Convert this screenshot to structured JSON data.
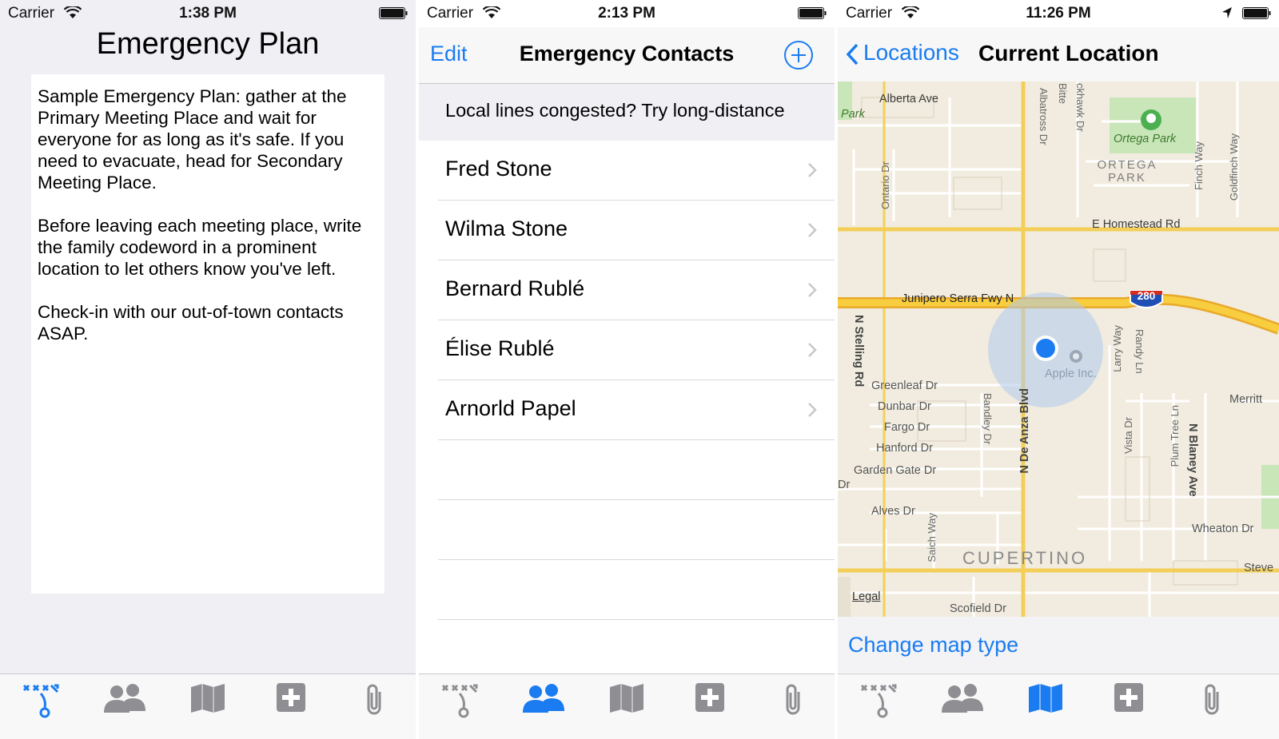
{
  "colors": {
    "accent": "#1a7cf0",
    "tab_inactive": "#8e8e93",
    "tab_active": "#1a7cf0"
  },
  "panel1": {
    "status": {
      "carrier": "Carrier",
      "time": "1:38 PM"
    },
    "title": "Emergency Plan",
    "paragraphs": [
      "Sample Emergency Plan: gather at the Primary Meeting Place and wait for everyone for as long as it's safe. If you need to evacuate, head for Secondary Meeting Place.",
      "Before leaving each meeting place, write the family codeword in a prominent location to let others know you've left.",
      "Check-in with our out-of-town contacts ASAP."
    ],
    "active_tab": "plan"
  },
  "panel2": {
    "status": {
      "carrier": "Carrier",
      "time": "2:13 PM"
    },
    "nav": {
      "edit": "Edit",
      "title": "Emergency Contacts",
      "add_icon": "add-circle-icon"
    },
    "banner": "Local lines congested? Try long-distance",
    "contacts": [
      "Fred Stone",
      "Wilma Stone",
      "Bernard Rublé",
      "Élise Rublé",
      "Arnorld Papel"
    ],
    "active_tab": "contacts"
  },
  "panel3": {
    "status": {
      "carrier": "Carrier",
      "time": "11:26 PM"
    },
    "nav": {
      "back": "Locations",
      "title": "Current Location"
    },
    "map": {
      "labels": {
        "alberta": "Alberta Ave",
        "park": "Park",
        "albatross": "Albatross Dr",
        "bitte": "Bitte",
        "ckhawk": "ckhawk Dr",
        "ortega_park": "Ortega Park",
        "ortega_park_caps": "ORTEGA PARK",
        "finch": "Finch Way",
        "goldfinch": "Goldfinch Way",
        "ontario": "Ontario Dr",
        "homestead": "E Homestead Rd",
        "junipero": "Junipero Serra Fwy N",
        "i280": "280",
        "stelling": "N Stelling Rd",
        "larry": "Larry Way",
        "randy": "Randy Ln",
        "apple": "Apple Inc.",
        "greenleaf": "Greenleaf Dr",
        "dunbar": "Dunbar Dr",
        "fargo": "Fargo Dr",
        "hanford": "Hanford Dr",
        "garden_gate": "Garden Gate Dr",
        "bandley": "Bandley Dr",
        "de_anza": "N De Anza Blvd",
        "vista": "Vista Dr",
        "plum_tree": "Plum Tree Ln",
        "blaney": "N Blaney Ave",
        "merritt": "Merritt",
        "dr": "Dr",
        "alves": "Alves Dr",
        "saich": "Saich Way",
        "wheaton": "Wheaton Dr",
        "cupertino": "CUPERTINO",
        "steve": "Steve",
        "legal": "Legal",
        "scofield": "Scofield Dr"
      }
    },
    "change_map": "Change map type",
    "active_tab": "map"
  },
  "tabs": [
    {
      "key": "plan",
      "icon": "strategy-plan-icon"
    },
    {
      "key": "contacts",
      "icon": "contacts-group-icon"
    },
    {
      "key": "map",
      "icon": "folded-map-icon"
    },
    {
      "key": "firstaid",
      "icon": "first-aid-plus-icon"
    },
    {
      "key": "attachments",
      "icon": "paperclip-icon"
    }
  ]
}
